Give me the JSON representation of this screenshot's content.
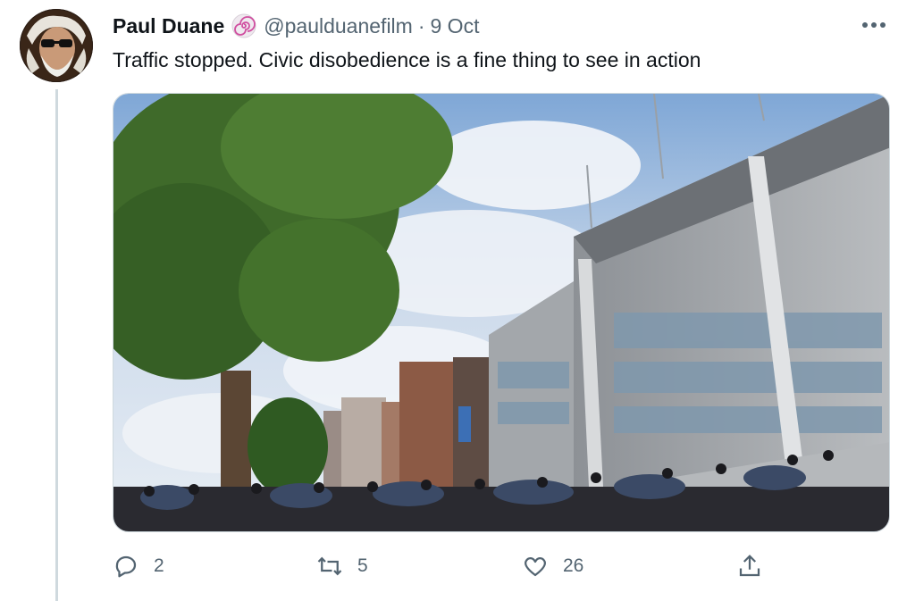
{
  "tweet": {
    "author_name": "Paul Duane",
    "handle": "@paulduanefilm",
    "separator": "·",
    "timestamp": "9 Oct",
    "text": "Traffic stopped. Civic disobedience is a fine thing to see in action",
    "badge_icon": "spiral-badge-icon",
    "media_icon": "photo-crowd-outside-building"
  },
  "actions": {
    "reply_count": "2",
    "retweet_count": "5",
    "like_count": "26"
  },
  "colors": {
    "text_primary": "#0f1419",
    "text_secondary": "#536471",
    "thread_line": "#cfd9de"
  }
}
